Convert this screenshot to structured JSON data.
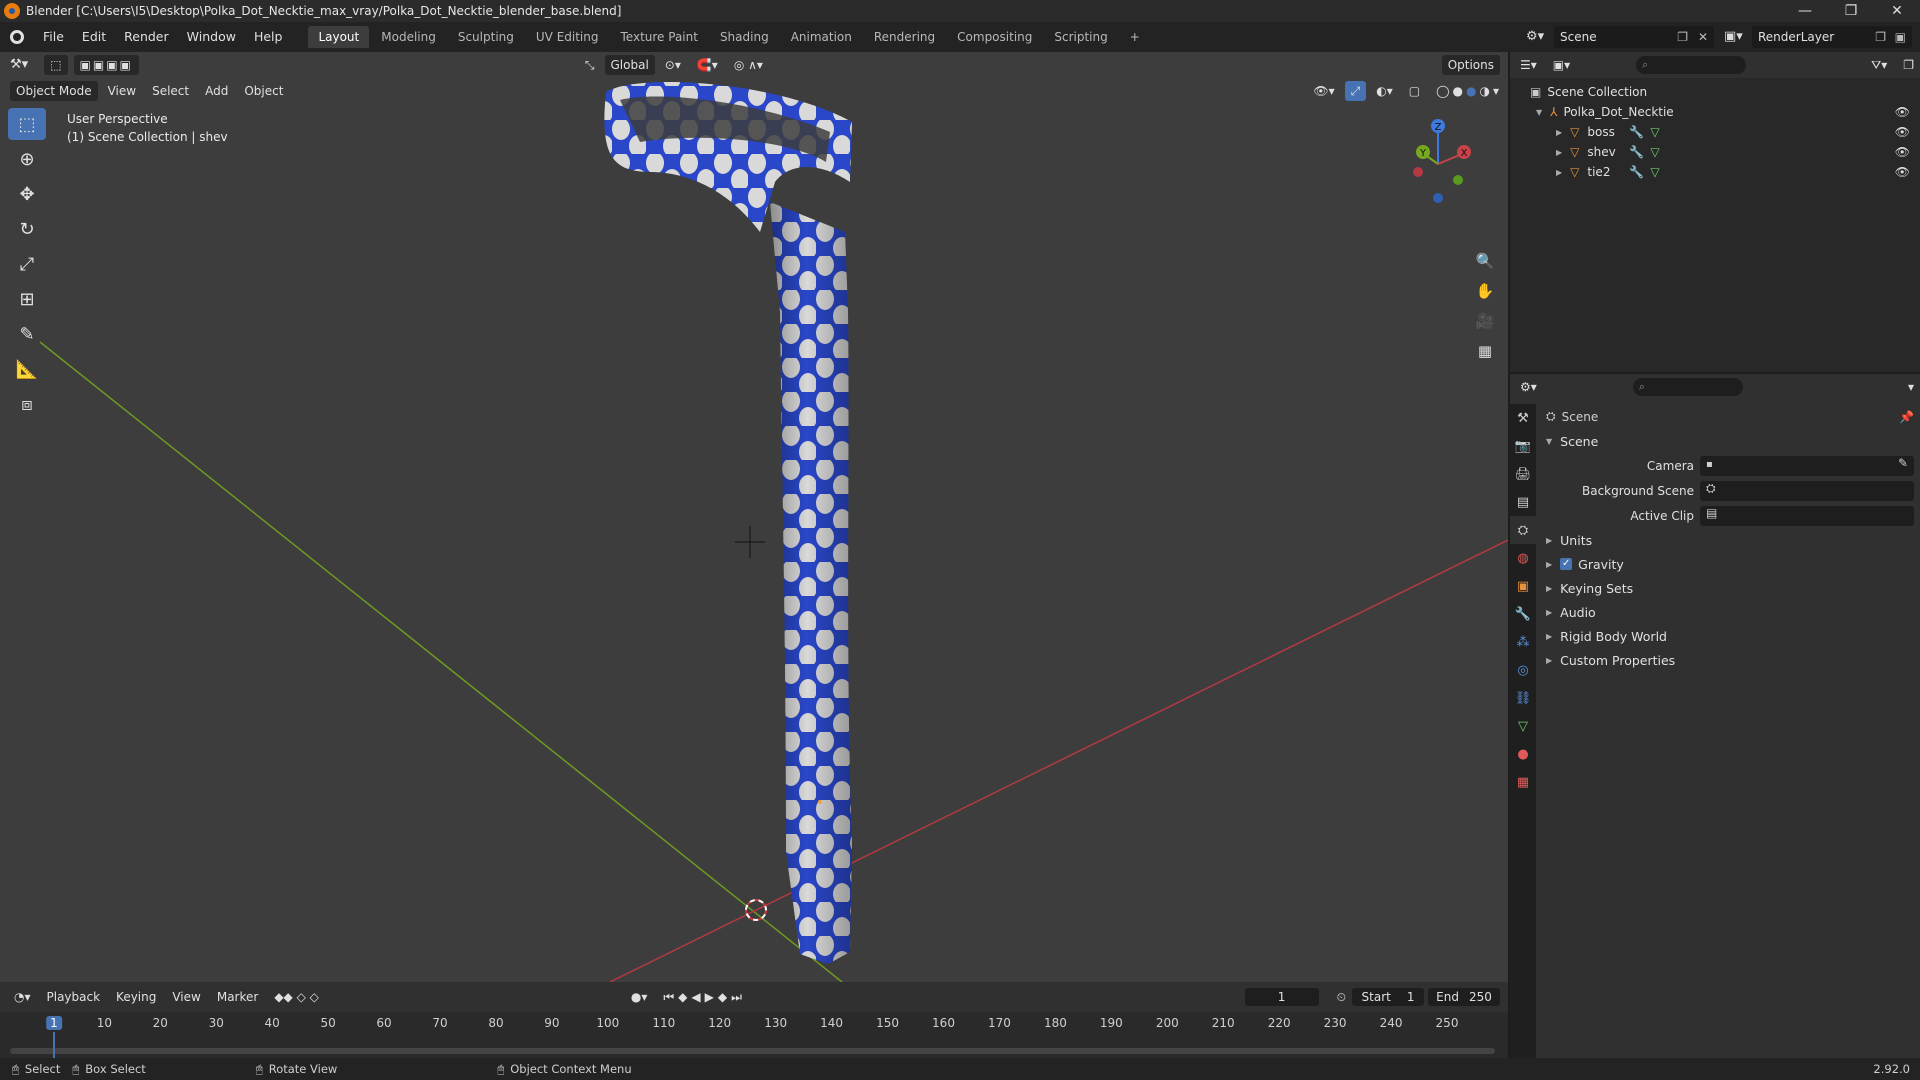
{
  "window": {
    "title": "Blender [C:\\Users\\I5\\Desktop\\Polka_Dot_Necktie_max_vray/Polka_Dot_Necktie_blender_base.blend]",
    "minimize": "—",
    "restore": "❐",
    "close": "✕"
  },
  "menu": [
    "File",
    "Edit",
    "Render",
    "Window",
    "Help"
  ],
  "workspaces": [
    {
      "label": "Layout",
      "active": true
    },
    {
      "label": "Modeling"
    },
    {
      "label": "Sculpting"
    },
    {
      "label": "UV Editing"
    },
    {
      "label": "Texture Paint"
    },
    {
      "label": "Shading"
    },
    {
      "label": "Animation"
    },
    {
      "label": "Rendering"
    },
    {
      "label": "Compositing"
    },
    {
      "label": "Scripting"
    }
  ],
  "add_workspace": "+",
  "scene_selector": "Scene",
  "render_layer": "RenderLayer",
  "viewport": {
    "transform_orientation": "Global",
    "options": "Options",
    "mode": "Object Mode",
    "menus": [
      "View",
      "Select",
      "Add",
      "Object"
    ],
    "perspective": "User Perspective",
    "collection_info": "(1) Scene Collection | shev",
    "axes": {
      "x": "X",
      "y": "Y",
      "z": "Z"
    }
  },
  "outliner": {
    "root": "Scene Collection",
    "collection": "Polka_Dot_Necktie",
    "objects": [
      "boss",
      "shev",
      "tie2"
    ]
  },
  "properties": {
    "header": "Scene",
    "panel": "Scene",
    "fields": [
      {
        "label": "Camera"
      },
      {
        "label": "Background Scene"
      },
      {
        "label": "Active Clip"
      }
    ],
    "subpanels": [
      "Units",
      "Gravity",
      "Keying Sets",
      "Audio",
      "Rigid Body World",
      "Custom Properties"
    ],
    "gravity_checked": true,
    "tab_colors": [
      "#cfcfcf",
      "#cfcfcf",
      "#cfcfcf",
      "#cfcfcf",
      "#cfcfcf",
      "#e05a5a",
      "#e8923c",
      "#5a93e0",
      "#5a93e0",
      "#5a93e0",
      "#5a93e0",
      "#6fcf6f",
      "#e05a5a",
      "#e05a5a"
    ]
  },
  "timeline": {
    "menus": [
      "Playback",
      "Keying",
      "View",
      "Marker"
    ],
    "current_frame": "1",
    "start_label": "Start",
    "start": "1",
    "end_label": "End",
    "end": "250",
    "ticks": [
      "1",
      "10",
      "20",
      "30",
      "40",
      "50",
      "60",
      "70",
      "80",
      "90",
      "100",
      "110",
      "120",
      "130",
      "140",
      "150",
      "160",
      "170",
      "180",
      "190",
      "200",
      "210",
      "220",
      "230",
      "240",
      "250"
    ]
  },
  "statusbar": {
    "select": "Select",
    "box_select": "Box Select",
    "rotate_view": "Rotate View",
    "context_menu": "Object Context Menu",
    "version": "2.92.0"
  },
  "colors": {
    "accent": "#4772b3",
    "tie_blue": "#2a47c9",
    "dot": "#d9d9d9",
    "x_axis": "#c8424a",
    "y_axis": "#76a91f",
    "z_axis": "#3d7be3"
  }
}
